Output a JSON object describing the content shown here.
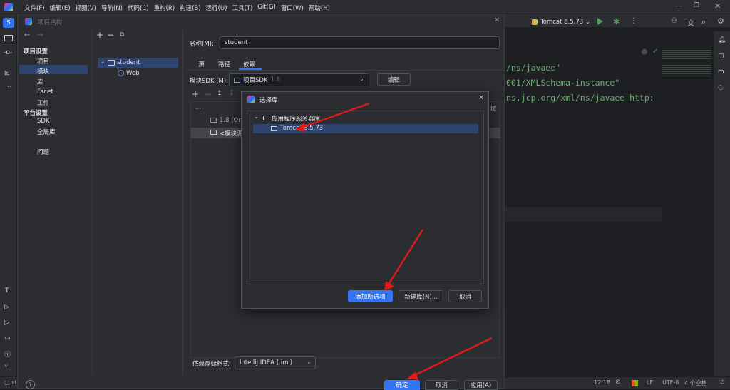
{
  "app": {
    "logo_letter": "S"
  },
  "menu": [
    "文件(F)",
    "编辑(E)",
    "视图(V)",
    "导航(N)",
    "代码(C)",
    "重构(R)",
    "构建(B)",
    "运行(U)",
    "工具(T)",
    "Git(G)",
    "窗口(W)",
    "帮助(H)"
  ],
  "run_config": {
    "label": "Tomcat 8.5.73"
  },
  "editor": {
    "lines": [
      "/ns/javaee\"",
      "001/XMLSchema-instance\"",
      "ns.jcp.org/xml/ns/javaee http:"
    ]
  },
  "project_structure": {
    "title": "项目结构",
    "sections": [
      {
        "header": "项目设置",
        "items": [
          "项目",
          "模块",
          "库",
          "Facet",
          "工件"
        ]
      },
      {
        "header": "平台设置",
        "items": [
          "SDK",
          "全局库"
        ]
      }
    ],
    "problems": "问题",
    "selected_nav": "模块",
    "tree": {
      "module": "student",
      "facet": "Web"
    },
    "name_label": "名称(M):",
    "name_value": "student",
    "tabs": [
      "源",
      "路径",
      "依赖"
    ],
    "active_tab": "依赖",
    "sdk_label": "模块SDK (M):",
    "sdk_value": "项目SDK",
    "sdk_version": "1.8",
    "edit_button": "编辑",
    "dep_header_right": "域",
    "dep_rows": [
      "1.8 (Ora",
      "<模块源"
    ],
    "storage_label": "依赖存储格式:",
    "storage_value": "IntelliJ IDEA (.iml)",
    "ok": "确定",
    "cancel": "取消",
    "apply": "应用(A)"
  },
  "choose_library": {
    "title": "选择库",
    "group": "应用程序服务器库",
    "item": "Tomcat 8.5.73",
    "add_selected": "添加所选项",
    "new_library": "新建库(N)...",
    "cancel": "取消"
  },
  "status": {
    "left": "st",
    "time": "12:18",
    "line_sep": "LF",
    "encoding": "UTF-8",
    "indent": "4 个空格"
  },
  "colors": {
    "accent": "#3574f0",
    "selection": "#2e436e",
    "arrow": "#e0191b"
  }
}
